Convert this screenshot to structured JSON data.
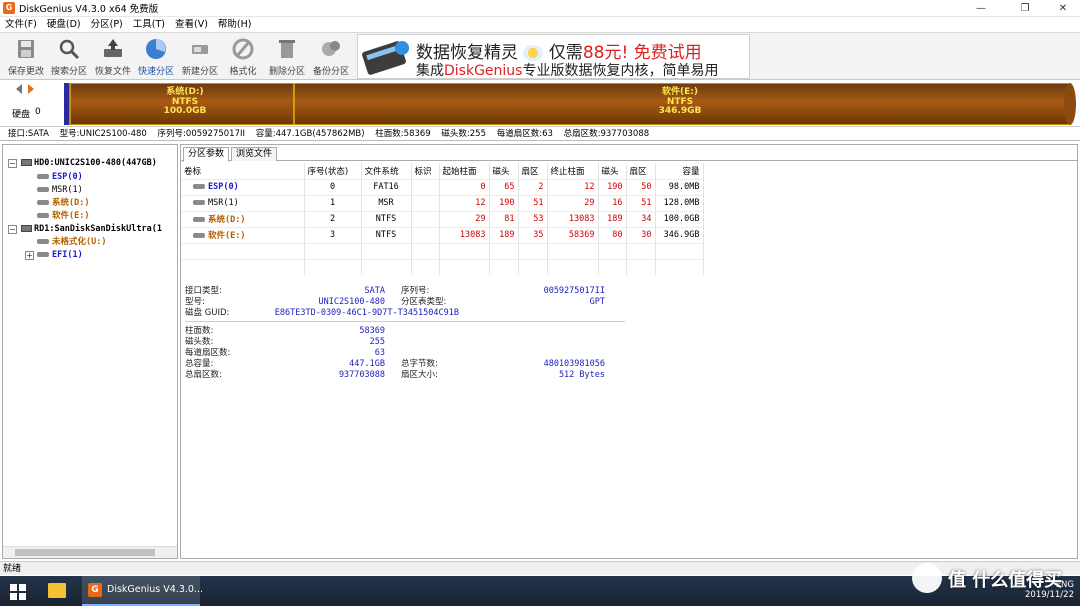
{
  "window": {
    "title": "DiskGenius V4.3.0 x64 免费版",
    "controls": {
      "minimize": "—",
      "maximize": "❐",
      "close": "✕"
    }
  },
  "menu": [
    "文件(F)",
    "硬盘(D)",
    "分区(P)",
    "工具(T)",
    "查看(V)",
    "帮助(H)"
  ],
  "toolbar": [
    {
      "label": "保存更改",
      "icon": "save-icon"
    },
    {
      "label": "搜索分区",
      "icon": "search-icon"
    },
    {
      "label": "恢复文件",
      "icon": "recover-icon"
    },
    {
      "label": "快速分区",
      "icon": "quick-partition-icon"
    },
    {
      "label": "新建分区",
      "icon": "new-partition-icon"
    },
    {
      "label": "格式化",
      "icon": "format-icon"
    },
    {
      "label": "删除分区",
      "icon": "delete-icon"
    },
    {
      "label": "备份分区",
      "icon": "backup-icon"
    }
  ],
  "banner": {
    "line1_a": "数据恢复精灵",
    "line1_b": "仅需",
    "line1_price": "88元!",
    "line1_c": "免费试用",
    "line2_a": "集成",
    "line2_brand": "DiskGenius",
    "line2_b": "专业版数据恢复内核，简单易用"
  },
  "diskbar": {
    "label": "硬盘",
    "number": "0",
    "partitions": [
      {
        "name": "系统(D:)",
        "fs": "NTFS",
        "size": "100.0GB"
      },
      {
        "name": "软件(E:)",
        "fs": "NTFS",
        "size": "346.9GB"
      }
    ]
  },
  "infoline": {
    "interface": "接口:SATA",
    "model": "型号:UNIC2S100-480",
    "serial": "序列号:0059275017II",
    "capacity": "容量:447.1GB(457862MB)",
    "cylinders": "柱面数:58369",
    "heads": "磁头数:255",
    "sectors_per_track": "每道扇区数:63",
    "total_sectors": "总扇区数:937703088"
  },
  "tree": {
    "hd0": "HD0:UNIC2S100-480(447GB)",
    "hd0_parts": [
      "ESP(0)",
      "MSR(1)",
      "系统(D:)",
      "软件(E:)"
    ],
    "rd1": "RD1:SanDiskSanDiskUltra(1",
    "rd1_parts": [
      "未格式化(U:)",
      "EFI(1)"
    ]
  },
  "tabs": [
    "分区参数",
    "浏览文件"
  ],
  "table": {
    "headers": [
      "卷标",
      "序号(状态)",
      "文件系统",
      "标识",
      "起始柱面",
      "磁头",
      "扇区",
      "终止柱面",
      "磁头",
      "扇区",
      "容量"
    ],
    "rows": [
      {
        "name": "ESP(0)",
        "idx": "0",
        "fs": "FAT16",
        "flag": "",
        "sc": "0",
        "sh": "65",
        "ss": "2",
        "ec": "12",
        "eh": "190",
        "es": "50",
        "cap": "98.0MB"
      },
      {
        "name": "MSR(1)",
        "idx": "1",
        "fs": "MSR",
        "flag": "",
        "sc": "12",
        "sh": "190",
        "ss": "51",
        "ec": "29",
        "eh": "16",
        "es": "51",
        "cap": "128.0MB"
      },
      {
        "name": "系统(D:)",
        "idx": "2",
        "fs": "NTFS",
        "flag": "",
        "sc": "29",
        "sh": "81",
        "ss": "53",
        "ec": "13083",
        "eh": "189",
        "es": "34",
        "cap": "100.0GB"
      },
      {
        "name": "软件(E:)",
        "idx": "3",
        "fs": "NTFS",
        "flag": "",
        "sc": "13083",
        "sh": "189",
        "ss": "35",
        "ec": "58369",
        "eh": "80",
        "es": "30",
        "cap": "346.9GB"
      }
    ]
  },
  "details": {
    "iface_label": "接口类型:",
    "iface": "SATA",
    "serial_label": "序列号:",
    "serial": "0059275017II",
    "model_label": "型号:",
    "model": "UNIC2S100-480",
    "pt_label": "分区表类型:",
    "pt": "GPT",
    "guid_label": "磁盘 GUID:",
    "guid": "E86TE3TD-0309-46C1-9D7T-T3451504C91B",
    "cyl_label": "柱面数:",
    "cyl": "58369",
    "heads_label": "磁头数:",
    "heads": "255",
    "spt_label": "每道扇区数:",
    "spt": "63",
    "cap_label": "总容量:",
    "cap": "447.1GB",
    "bytes_label": "总字节数:",
    "bytes": "480103981056",
    "sectors_label": "总扇区数:",
    "sectors": "937703088",
    "secsize_label": "扇区大小:",
    "secsize": "512 Bytes"
  },
  "status": "就绪",
  "taskbar": {
    "app": "DiskGenius V4.3.0...",
    "lang": "ENG",
    "date": "2019/11/22"
  },
  "watermark": "值 什么值得买",
  "colors": {
    "partition_fill": "#a05412",
    "partition_text": "#ffe64a",
    "value_blue": "#2020c0",
    "number_red": "#d00000",
    "partition_name": "#b06000"
  }
}
